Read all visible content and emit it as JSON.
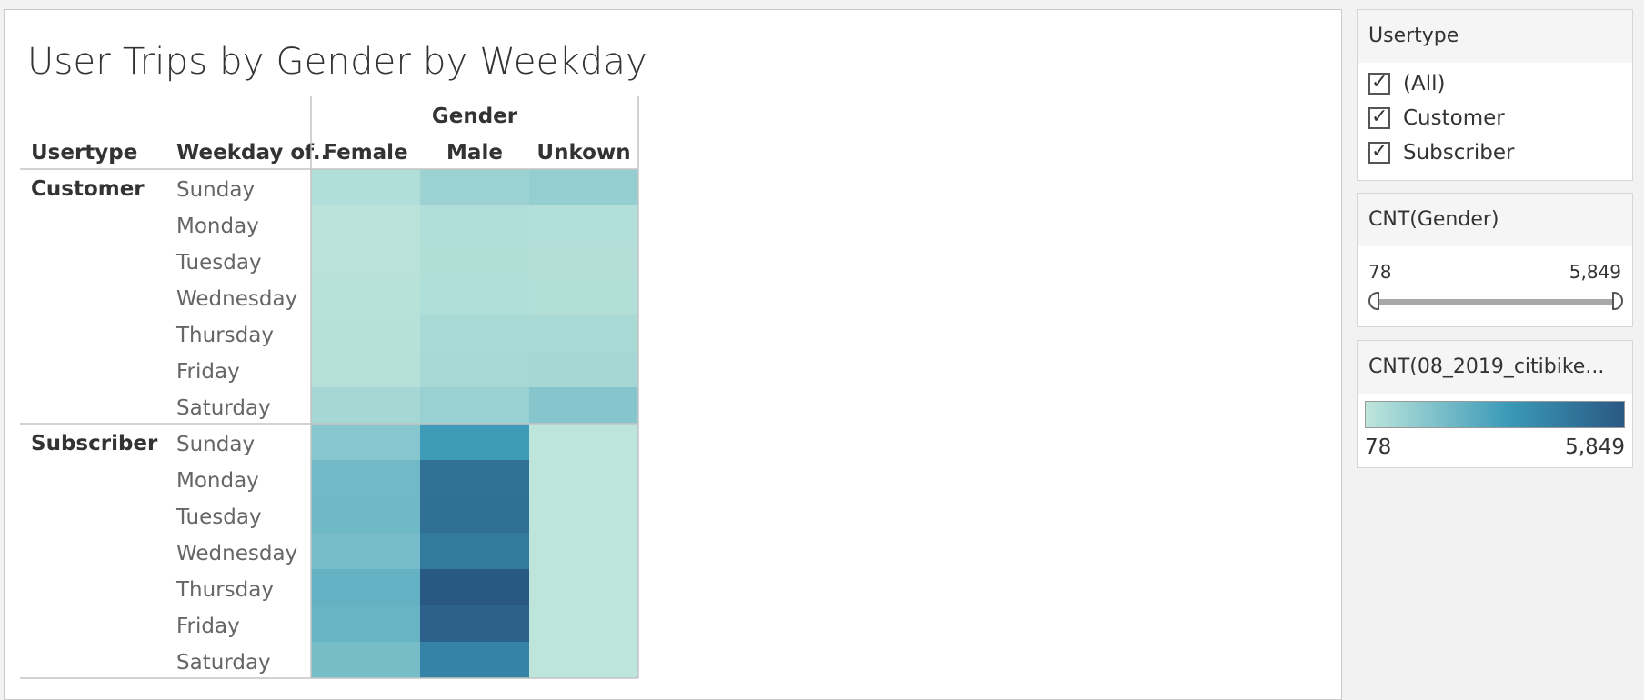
{
  "title": "User Trips by Gender by Weekday",
  "headers": {
    "gender": "Gender",
    "usertype": "Usertype",
    "weekday": "Weekday of..",
    "columns": [
      "Female",
      "Male",
      "Unkown"
    ]
  },
  "chart_data": {
    "type": "heatmap",
    "title": "User Trips by Gender by Weekday",
    "color_range": [
      78,
      5849
    ],
    "colors": {
      "low": "#bfe6dc",
      "mid": "#3b9ab8",
      "high": "#2a5884"
    },
    "groups": [
      {
        "usertype": "Customer",
        "rows": [
          {
            "weekday": "Sunday",
            "values": [
              420,
              900,
              1100
            ]
          },
          {
            "weekday": "Monday",
            "values": [
              250,
              420,
              380
            ]
          },
          {
            "weekday": "Tuesday",
            "values": [
              230,
              400,
              350
            ]
          },
          {
            "weekday": "Wednesday",
            "values": [
              260,
              430,
              360
            ]
          },
          {
            "weekday": "Thursday",
            "values": [
              300,
              600,
              600
            ]
          },
          {
            "weekday": "Friday",
            "values": [
              330,
              650,
              700
            ]
          },
          {
            "weekday": "Saturday",
            "values": [
              700,
              1000,
              1450
            ]
          }
        ]
      },
      {
        "usertype": "Subscriber",
        "rows": [
          {
            "weekday": "Sunday",
            "values": [
              1400,
              3150,
              100
            ]
          },
          {
            "weekday": "Monday",
            "values": [
              1950,
              4850,
              100
            ]
          },
          {
            "weekday": "Tuesday",
            "values": [
              2000,
              4900,
              110
            ]
          },
          {
            "weekday": "Wednesday",
            "values": [
              1850,
              4500,
              105
            ]
          },
          {
            "weekday": "Thursday",
            "values": [
              2300,
              5849,
              108
            ]
          },
          {
            "weekday": "Friday",
            "values": [
              2150,
              5500,
              106
            ]
          },
          {
            "weekday": "Saturday",
            "values": [
              1800,
              4100,
              115
            ]
          }
        ]
      }
    ]
  },
  "filters": {
    "usertype": {
      "title": "Usertype",
      "options": [
        {
          "label": "(All)",
          "checked": true
        },
        {
          "label": "Customer",
          "checked": true
        },
        {
          "label": "Subscriber",
          "checked": true
        }
      ]
    },
    "cnt_gender": {
      "title": "CNT(Gender)",
      "min_label": "78",
      "max_label": "5,849"
    }
  },
  "color_legend": {
    "title": "CNT(08_2019_citibike...",
    "min_label": "78",
    "max_label": "5,849"
  }
}
